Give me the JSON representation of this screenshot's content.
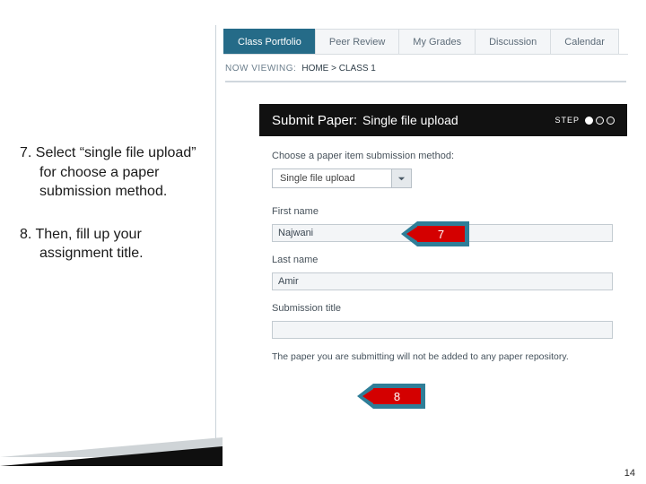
{
  "instructions": {
    "step7": "7. Select “single file upload” for choose a paper submission method.",
    "step8": "8. Then, fill up your assignment title."
  },
  "tabs": {
    "t0": "Class Portfolio",
    "t1": "Peer Review",
    "t2": "My Grades",
    "t3": "Discussion",
    "t4": "Calendar"
  },
  "viewing": {
    "label": "NOW VIEWING:",
    "path": "HOME > CLASS 1"
  },
  "title": {
    "lead": "Submit Paper:",
    "sub": "Single file upload",
    "step_label": "STEP"
  },
  "form": {
    "method_label": "Choose a paper item submission method:",
    "method_value": "Single file upload",
    "first_name_label": "First name",
    "first_name_value": "Najwani",
    "last_name_label": "Last name",
    "last_name_value": "Amir",
    "title_label": "Submission title",
    "title_value": "",
    "note": "The paper you are submitting will not be added to any paper repository."
  },
  "callouts": {
    "c7": "7",
    "c8": "8"
  },
  "page_number": "14"
}
